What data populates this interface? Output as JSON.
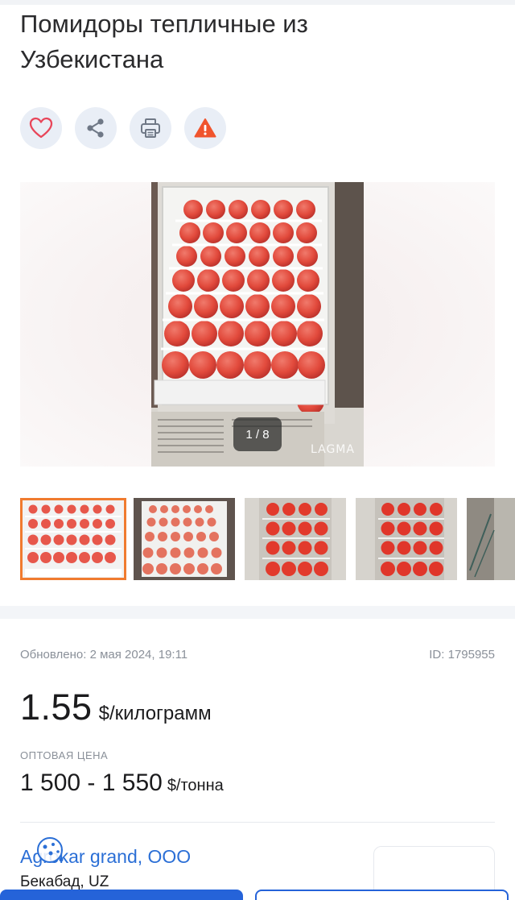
{
  "product": {
    "title_line1": "Помидоры тепличные из",
    "title_line2": "Узбекистана"
  },
  "actions": {
    "favorite_icon": "heart-icon",
    "share_icon": "share-icon",
    "print_icon": "printer-icon",
    "report_icon": "warning-icon"
  },
  "gallery": {
    "counter": "1 / 8",
    "watermark": "LAGMA"
  },
  "meta": {
    "updated": "Обновлено: 2 мая 2024, 19:11",
    "id": "ID: 1795955"
  },
  "price": {
    "value": "1.55",
    "unit": "$/килограмм"
  },
  "wholesale": {
    "label": "ОПТОВАЯ ЦЕНА",
    "value": "1 500 - 1 550",
    "unit": "$/тонна"
  },
  "seller": {
    "name": "Agrokar grand, OOO",
    "location": "Бекабад, UZ"
  },
  "colors": {
    "accent": "#2563d9",
    "active_thumb": "#f07b2f",
    "warning": "#f0542d",
    "link": "#2b6fd6"
  }
}
